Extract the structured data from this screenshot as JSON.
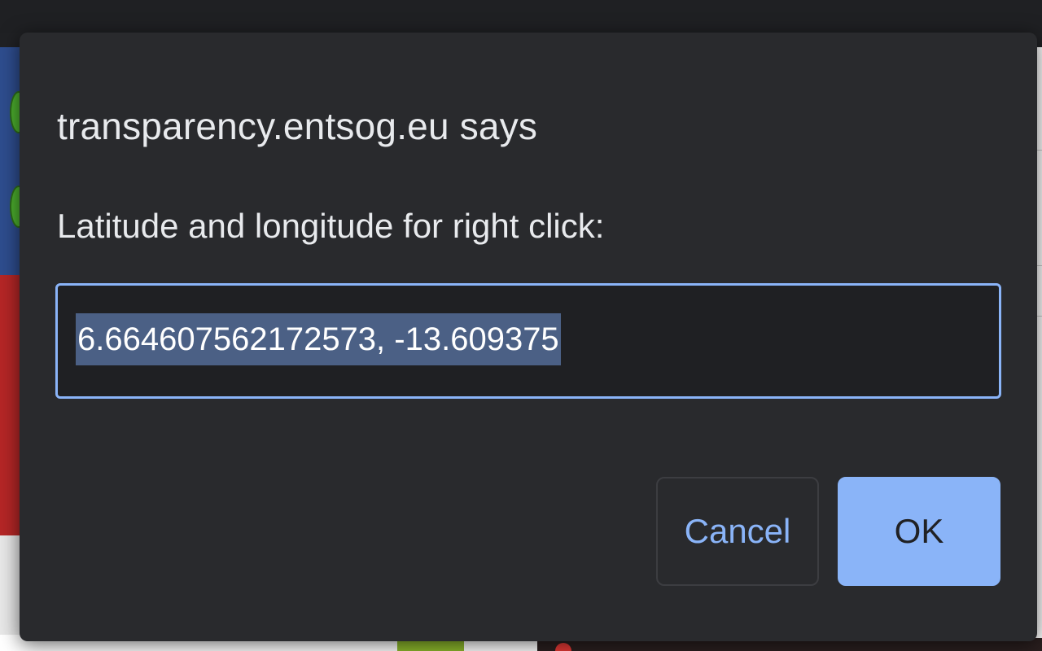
{
  "dialog": {
    "title": "transparency.entsog.eu says",
    "message": "Latitude and longitude for right click:",
    "input_value": "6.664607562172573, -13.609375",
    "cancel_label": "Cancel",
    "ok_label": "OK"
  },
  "colors": {
    "dialog_background": "#292a2d",
    "accent": "#8ab4f8",
    "text": "#e8eaed",
    "selection": "#4b6085"
  }
}
